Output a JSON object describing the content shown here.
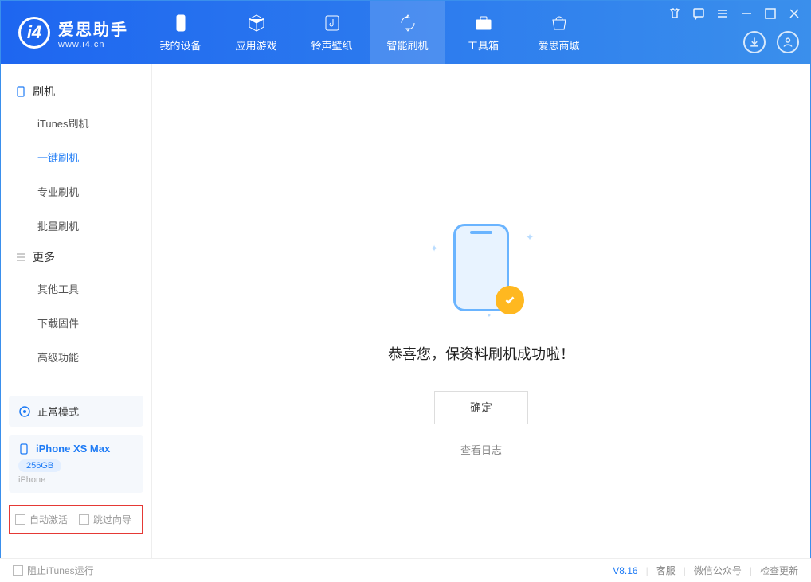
{
  "brand": {
    "cn": "爱思助手",
    "en": "www.i4.cn"
  },
  "tabs": [
    {
      "label": "我的设备"
    },
    {
      "label": "应用游戏"
    },
    {
      "label": "铃声壁纸"
    },
    {
      "label": "智能刷机"
    },
    {
      "label": "工具箱"
    },
    {
      "label": "爱思商城"
    }
  ],
  "sidebar": {
    "section1": "刷机",
    "items1": [
      "iTunes刷机",
      "一键刷机",
      "专业刷机",
      "批量刷机"
    ],
    "section2": "更多",
    "items2": [
      "其他工具",
      "下载固件",
      "高级功能"
    ]
  },
  "device": {
    "mode": "正常模式",
    "name": "iPhone XS Max",
    "storage": "256GB",
    "type": "iPhone"
  },
  "checkboxes": {
    "auto_activate": "自动激活",
    "skip_guide": "跳过向导"
  },
  "result": {
    "message": "恭喜您，保资料刷机成功啦！",
    "confirm": "确定",
    "log_link": "查看日志"
  },
  "footer": {
    "block_itunes": "阻止iTunes运行",
    "version": "V8.16",
    "support": "客服",
    "wechat": "微信公众号",
    "update": "检查更新"
  }
}
